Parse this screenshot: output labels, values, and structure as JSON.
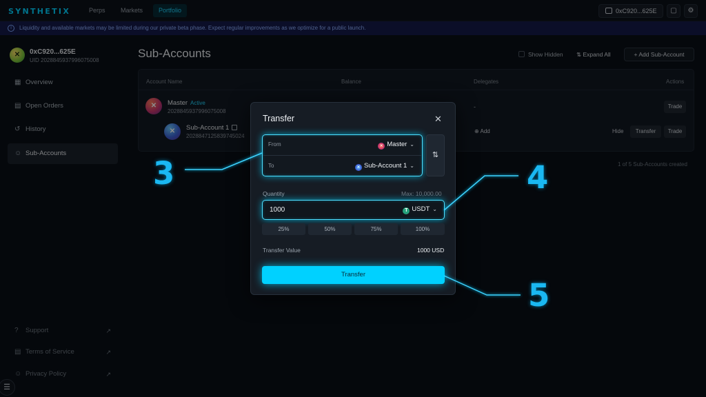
{
  "topbar": {
    "logo": "SYNTHETIX",
    "nav": [
      "Perps",
      "Markets",
      "Portfolio"
    ],
    "active_nav": "Portfolio",
    "wallet": "0xC920...625E",
    "chat_icon": "chat-icon",
    "settings_icon": "gear-icon"
  },
  "banner": {
    "text": "Liquidity and available markets may be limited during our private beta phase. Expect regular improvements as we optimize for a public launch.",
    "icon": "info-icon"
  },
  "sidebar": {
    "user_name": "0xC920...625E",
    "user_uid": "UID 2028845937996075008",
    "items": [
      {
        "label": "Overview",
        "icon": "grid-icon"
      },
      {
        "label": "Open Orders",
        "icon": "orders-icon"
      },
      {
        "label": "History",
        "icon": "history-icon"
      },
      {
        "label": "Sub-Accounts",
        "icon": "users-icon"
      }
    ],
    "active_item": "Sub-Accounts",
    "footer": [
      {
        "label": "Support",
        "icon": "help-icon"
      },
      {
        "label": "Terms of Service",
        "icon": "document-icon"
      },
      {
        "label": "Privacy Policy",
        "icon": "user-icon"
      }
    ]
  },
  "main": {
    "title": "Sub-Accounts",
    "show_hidden": "Show Hidden",
    "expand_all": "Expand All",
    "add_sub_account": "+ Add Sub-Account",
    "columns": [
      "Account Name",
      "Balance",
      "Delegates",
      "Actions"
    ],
    "rows": [
      {
        "name": "Master",
        "badge": "Active",
        "id": "2028845937996075008",
        "delegates": "-",
        "actions": [
          "Trade"
        ]
      },
      {
        "name": "Sub-Account 1",
        "id": "2028847125839745024",
        "delegates": "Add",
        "actions": [
          "Hide",
          "Transfer",
          "Trade"
        ]
      }
    ],
    "created_text": "1 of 5 Sub-Accounts created"
  },
  "modal": {
    "title": "Transfer",
    "from_label": "From",
    "from_value": "Master",
    "to_label": "To",
    "to_value": "Sub-Account 1",
    "quantity_label": "Quantity",
    "max_text": "Max: 10,000.00",
    "quantity_value": "1000",
    "token": "USDT",
    "percent_options": [
      "25%",
      "50%",
      "75%",
      "100%"
    ],
    "transfer_value_label": "Transfer Value",
    "transfer_value": "1000 USD",
    "submit_label": "Transfer"
  },
  "callouts": [
    "3",
    "4",
    "5"
  ],
  "colors": {
    "accent": "#00d1ff",
    "callout": "#1ab8f2",
    "banner_bg": "#151a4a"
  }
}
